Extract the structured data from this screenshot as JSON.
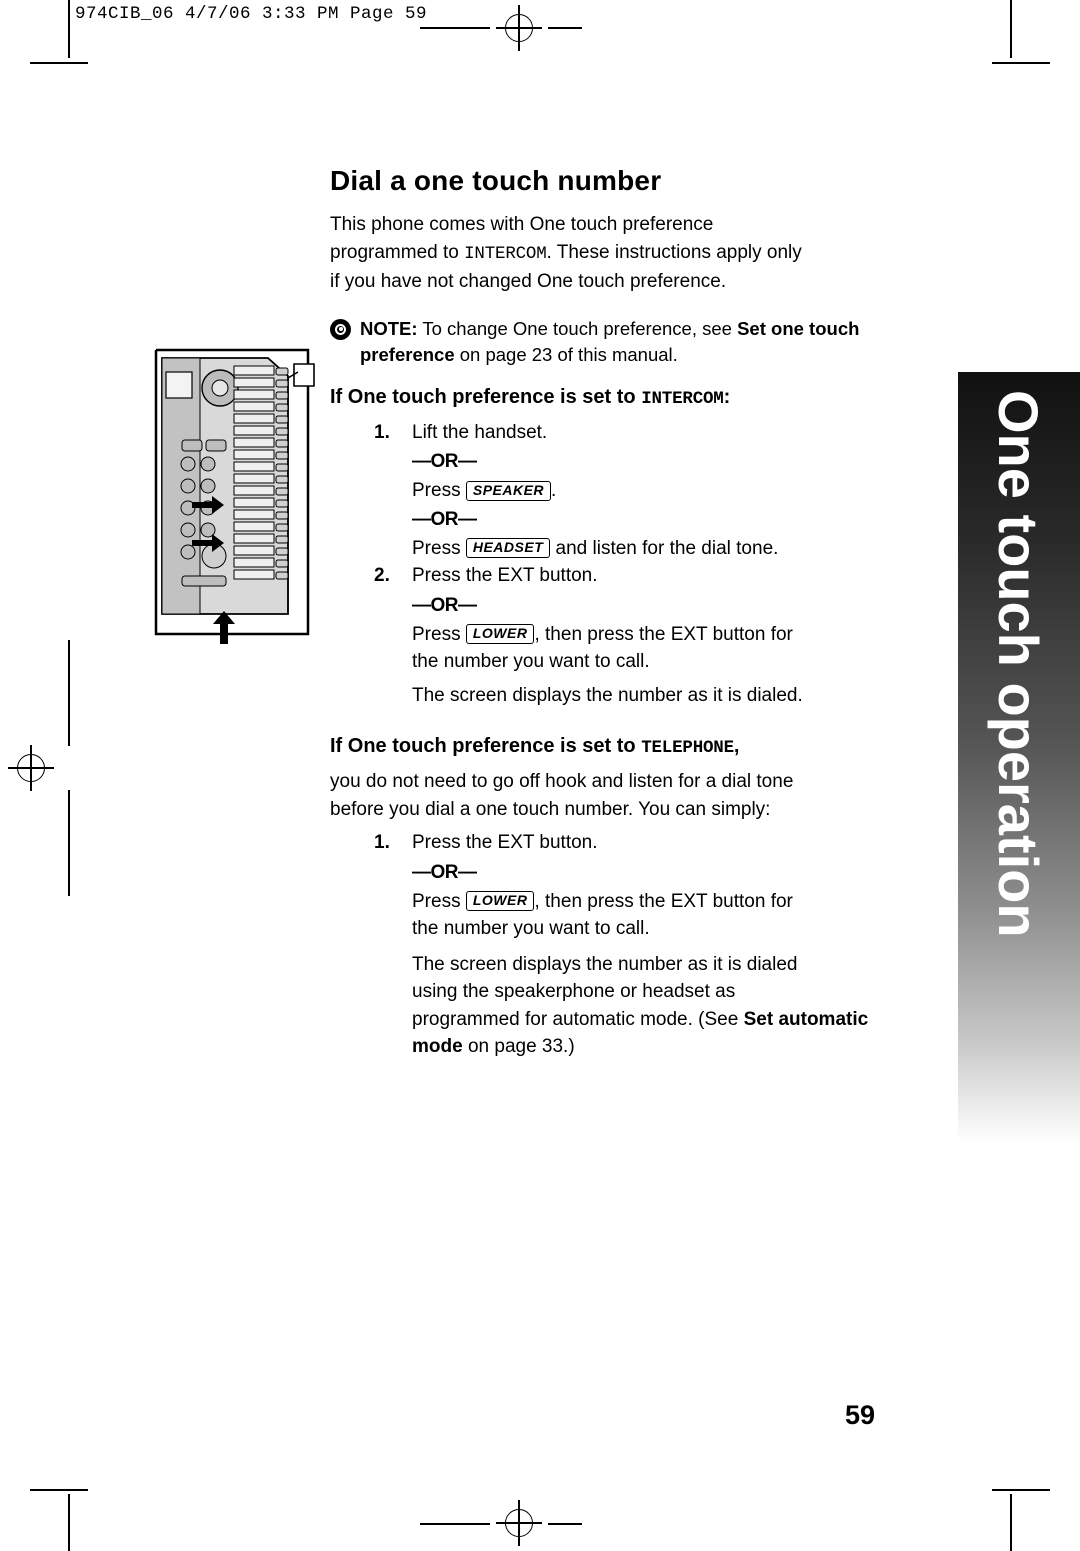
{
  "slug": "974CIB_06  4/7/06  3:33 PM  Page 59",
  "title": "Dial a one touch number",
  "intro": {
    "line1": "This phone comes with One touch preference",
    "line2_pre": "programmed to ",
    "line2_mono": "INTERCOM",
    "line2_post": ". These instructions apply only",
    "line3": "if you have not changed One touch preference."
  },
  "note": {
    "label": "NOTE:",
    "text_pre": "To change One touch preference,  see ",
    "bold1": "Set one touch preference",
    "text_post": " on page 23 of this manual."
  },
  "section1": {
    "heading_pre": "If One touch preference is set to ",
    "heading_mono": "INTERCOM",
    "heading_post": ":",
    "steps": [
      {
        "num": "1.",
        "text": "Lift the handset."
      },
      {
        "num": "2.",
        "text": "Press the EXT button."
      }
    ],
    "or_label": "—OR—",
    "press_word": "Press",
    "keys": {
      "speaker": "SPEAKER",
      "headset": "HEADSET",
      "lower": "LOWER"
    },
    "press_speaker_suffix": ".",
    "press_headset_suffix": " and listen for the dial tone.",
    "press_lower_line1": ", then press the EXT button for",
    "press_lower_line2": "the number you want to call.",
    "result": "The screen displays the number as it is dialed."
  },
  "section2": {
    "heading_pre": "If One touch preference is set to ",
    "heading_mono": "TELEPHONE",
    "heading_post": ",",
    "body_line1": "you do not need to go off hook and listen for a dial tone",
    "body_line2": "before you dial a one touch number. You can simply:",
    "step1_num": "1.",
    "step1_text": "Press the EXT button.",
    "or_label": "—OR—",
    "press_word": "Press",
    "key_lower": "LOWER",
    "press_lower_line1": ", then press the EXT button for",
    "press_lower_line2": "the number you want to call.",
    "result_line1": "The screen displays the number as it is dialed",
    "result_line2": "using the speakerphone or headset as",
    "result_line3_pre": "programmed for automatic mode.  (See ",
    "result_bold": "Set automatic mode",
    "result_line3_post": " on page 33.)"
  },
  "side_tab": {
    "label": "One touch operation",
    "gradient_top": "#111111",
    "gradient_bottom": "#ffffff"
  },
  "page_number": "59",
  "icons": {
    "note_bullet": "target-bullet-icon",
    "registration": "registration-mark-icon",
    "phone": "phone-illustration"
  }
}
